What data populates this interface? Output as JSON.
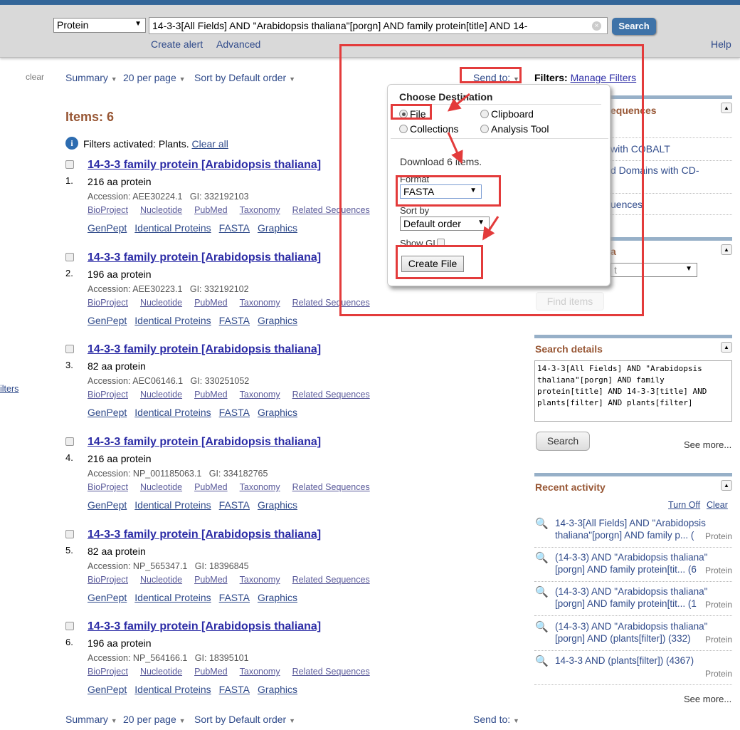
{
  "search": {
    "database": "Protein",
    "term": "14-3-3[All Fields] AND \"Arabidopsis thaliana\"[porgn] AND family protein[title] AND 14-",
    "button": "Search",
    "create_alert": "Create alert",
    "advanced": "Advanced",
    "help": "Help"
  },
  "toolbar": {
    "clear": "clear",
    "format": "Summary",
    "per_page": "20 per page",
    "sort": "Sort by Default order",
    "send_to": "Send to:",
    "filters_label": "Filters:",
    "manage_filters": "Manage Filters"
  },
  "items_count": "Items: 6",
  "filters_note": {
    "text": "Filters activated: Plants.",
    "clear_all": "Clear all"
  },
  "left_edge_link": "ilters",
  "results": [
    {
      "num": "1.",
      "title": "14-3-3 family protein [Arabidopsis thaliana]",
      "desc": "216 aa protein",
      "accession": "Accession: AEE30224.1",
      "gi": "GI: 332192103"
    },
    {
      "num": "2.",
      "title": "14-3-3 family protein [Arabidopsis thaliana]",
      "desc": "196 aa protein",
      "accession": "Accession: AEE30223.1",
      "gi": "GI: 332192102"
    },
    {
      "num": "3.",
      "title": "14-3-3 family protein [Arabidopsis thaliana]",
      "desc": "82 aa protein",
      "accession": "Accession: AEC06146.1",
      "gi": "GI: 330251052"
    },
    {
      "num": "4.",
      "title": "14-3-3 family protein [Arabidopsis thaliana]",
      "desc": "216 aa protein",
      "accession": "Accession: NP_001185063.1",
      "gi": "GI: 334182765"
    },
    {
      "num": "5.",
      "title": "14-3-3 family protein [Arabidopsis thaliana]",
      "desc": "82 aa protein",
      "accession": "Accession: NP_565347.1",
      "gi": "GI: 18396845"
    },
    {
      "num": "6.",
      "title": "14-3-3 family protein [Arabidopsis thaliana]",
      "desc": "196 aa protein",
      "accession": "Accession: NP_564166.1",
      "gi": "GI: 18395101"
    }
  ],
  "result_links1": [
    "BioProject",
    "Nucleotide",
    "PubMed",
    "Taxonomy",
    "Related Sequences"
  ],
  "result_links2": [
    "GenPept",
    "Identical Proteins",
    "FASTA",
    "Graphics"
  ],
  "popup": {
    "title": "Choose Destination",
    "options": [
      "File",
      "Clipboard",
      "Collections",
      "Analysis Tool"
    ],
    "selected": "File",
    "download": "Download 6 items.",
    "format_label": "Format",
    "format_value": "FASTA",
    "sortby_label": "Sort by",
    "sortby_value": "Default order",
    "show_gi": "Show GI",
    "create": "Create File"
  },
  "sidebar": {
    "analyze_title": "equences",
    "analyze_items": [
      "with COBALT",
      "d Domains with CD-",
      "uences"
    ],
    "box2_title": "a",
    "box2_select": "t",
    "find_items": "Find items",
    "details_title": "Search details",
    "details_text": "14-3-3[All Fields] AND \"Arabidopsis thaliana\"[porgn] AND family protein[title] AND 14-3-3[title] AND plants[filter] AND plants[filter]",
    "details_search": "Search",
    "details_more": "See more...",
    "recent_title": "Recent activity",
    "turn_off": "Turn Off",
    "clear": "Clear",
    "recent": [
      {
        "l1": "14-3-3[All Fields] AND \"Arabidopsis",
        "l2": "thaliana\"[porgn] AND family p... (",
        "db": "Protein"
      },
      {
        "l1": "(14-3-3) AND \"Arabidopsis thaliana\"",
        "l2": "[porgn] AND family protein[tit... (6",
        "db": "Protein"
      },
      {
        "l1": "(14-3-3) AND \"Arabidopsis thaliana\"",
        "l2": "[porgn] AND family protein[tit... (1",
        "db": "Protein"
      },
      {
        "l1": "(14-3-3) AND \"Arabidopsis thaliana\"",
        "l2": "[porgn] AND (plants[filter]) (332)",
        "db": "Protein"
      },
      {
        "l1": "14-3-3 AND (plants[filter]) (4367)",
        "l2": "",
        "db": "Protein"
      }
    ],
    "recent_more": "See more..."
  },
  "colors": {
    "header": "#336699",
    "accent_brown": "#985735",
    "link": "#2c2ca6",
    "annotation_red": "#e33b3b"
  }
}
